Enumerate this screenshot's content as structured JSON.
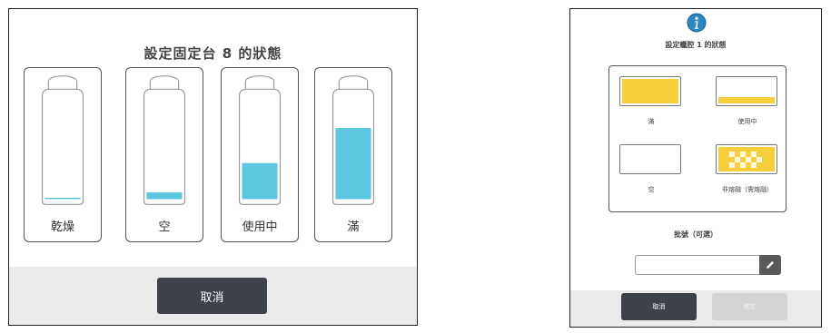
{
  "left_dialog": {
    "title": "設定固定台 8 的狀態",
    "options": [
      {
        "label": "乾燥",
        "fill_fraction": 0.01
      },
      {
        "label": "空",
        "fill_fraction": 0.07
      },
      {
        "label": "使用中",
        "fill_fraction": 0.37
      },
      {
        "label": "滿",
        "fill_fraction": 0.73
      }
    ],
    "cancel_label": "取消",
    "colors": {
      "liquid": "#5bc8df",
      "panel_bg": "#ebebeb",
      "button_dark": "#3d4149"
    }
  },
  "right_dialog": {
    "info_icon": "info-icon",
    "title": "設定蠟腔 1 的狀態",
    "options": [
      {
        "label": "滿",
        "state": "full"
      },
      {
        "label": "使用中",
        "state": "in-use"
      },
      {
        "label": "空",
        "state": "empty"
      },
      {
        "label": "非熔融（需熔融）",
        "state": "not-molten"
      }
    ],
    "batch_label": "批號（可選）",
    "batch_value": "",
    "edit_icon": "pencil-icon",
    "cancel_label": "取消",
    "confirm_label": "確定",
    "colors": {
      "wax": "#f7cf3c",
      "info": "#2e86c1"
    }
  }
}
